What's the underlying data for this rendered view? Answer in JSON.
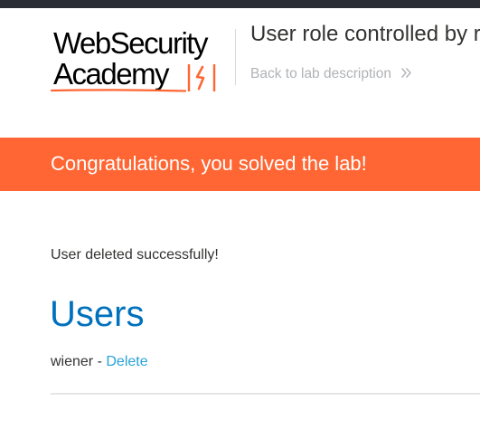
{
  "logo": {
    "line1": "WebSecurity",
    "line2": "Academy",
    "mark_icon": "lightning-bolt-bracket-icon",
    "brand_color": "#ff6633"
  },
  "header": {
    "lab_title": "User role controlled by r",
    "back_link_label": "Back to lab description",
    "back_icon": "double-chevron-right-icon"
  },
  "banner": {
    "text": "Congratulations, you solved the lab!",
    "color": "#ff6633"
  },
  "main": {
    "message": "User deleted successfully!",
    "heading": "Users",
    "users": [
      {
        "name": "wiener",
        "separator": " - ",
        "action_label": "Delete"
      }
    ]
  },
  "colors": {
    "heading": "#0071bc",
    "link": "#29a2d8",
    "text": "#333332",
    "top_bar": "#2a2d33"
  }
}
